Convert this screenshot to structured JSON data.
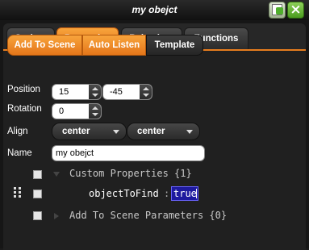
{
  "window": {
    "title": "my obejct"
  },
  "tabs": [
    {
      "label": "Sprites"
    },
    {
      "label": "Properties"
    },
    {
      "label": "Behaviors"
    },
    {
      "label": "Functions"
    }
  ],
  "active_tab": "Properties",
  "segments": [
    {
      "label": "Add To Scene",
      "active": true
    },
    {
      "label": "Auto Listen",
      "active": true
    },
    {
      "label": "Template",
      "active": false
    }
  ],
  "fields": {
    "position_label": "Position",
    "position_x": "15",
    "position_y": "-45",
    "rotation_label": "Rotation",
    "rotation": "0",
    "align_label": "Align",
    "align_h": "center",
    "align_v": "center",
    "name_label": "Name",
    "name": "my obejct"
  },
  "tree": {
    "custom_properties": "Custom Properties {1}",
    "property_key": "objectToFind",
    "separator": ":",
    "property_value": "true",
    "add_to_scene_params": "Add To Scene Parameters {0}"
  },
  "colors": {
    "accent": "#e87d1e",
    "value_highlight": "#1e1a9e"
  }
}
